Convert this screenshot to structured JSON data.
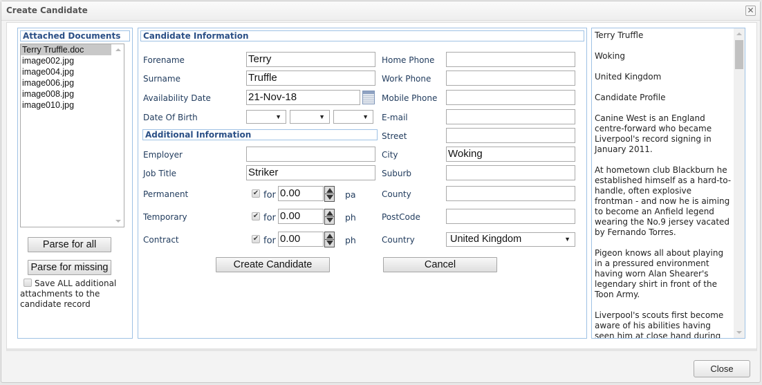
{
  "dialog": {
    "title": "Create Candidate",
    "close_icon": "close-x-icon",
    "footer_close_label": "Close"
  },
  "attached_documents": {
    "legend": "Attached Documents",
    "items": [
      {
        "name": "Terry Truffle.doc",
        "selected": true
      },
      {
        "name": "image002.jpg",
        "selected": false
      },
      {
        "name": "image004.jpg",
        "selected": false
      },
      {
        "name": "image006.jpg",
        "selected": false
      },
      {
        "name": "image008.jpg",
        "selected": false
      },
      {
        "name": "image010.jpg",
        "selected": false
      }
    ],
    "parse_all_label": "Parse for all",
    "parse_missing_label": "Parse for missing",
    "save_all_checked": false,
    "save_all_label": "Save ALL additional attachments to the candidate record"
  },
  "candidate_info": {
    "legend": "Candidate Information",
    "forename": {
      "label": "Forename",
      "value": "Terry"
    },
    "surname": {
      "label": "Surname",
      "value": "Truffle"
    },
    "availability_date": {
      "label": "Availability Date",
      "value": "21-Nov-18"
    },
    "date_of_birth": {
      "label": "Date Of Birth",
      "day": "",
      "month": "",
      "year": ""
    },
    "home_phone": {
      "label": "Home Phone",
      "value": ""
    },
    "work_phone": {
      "label": "Work Phone",
      "value": ""
    },
    "mobile_phone": {
      "label": "Mobile Phone",
      "value": ""
    },
    "email": {
      "label": "E-mail",
      "value": ""
    },
    "street": {
      "label": "Street",
      "value": ""
    },
    "city": {
      "label": "City",
      "value": "Woking"
    },
    "suburb": {
      "label": "Suburb",
      "value": ""
    },
    "county": {
      "label": "County",
      "value": ""
    },
    "postcode": {
      "label": "PostCode",
      "value": ""
    },
    "country": {
      "label": "Country",
      "value": "United Kingdom"
    }
  },
  "additional_info": {
    "legend": "Additional Information",
    "employer": {
      "label": "Employer",
      "value": ""
    },
    "job_title": {
      "label": "Job Title",
      "value": "Striker"
    },
    "for_label": "for",
    "permanent": {
      "label": "Permanent",
      "checked": true,
      "value": "0.00",
      "unit": "pa"
    },
    "temporary": {
      "label": "Temporary",
      "checked": true,
      "value": "0.00",
      "unit": "ph"
    },
    "contract": {
      "label": "Contract",
      "checked": true,
      "value": "0.00",
      "unit": "ph"
    }
  },
  "actions": {
    "create_label": "Create Candidate",
    "cancel_label": "Cancel"
  },
  "cv_text": "Terry Truffle\n\nWoking\n\nUnited Kingdom\n\nCandidate Profile\n\nCanine West is an England centre-forward who became Liverpool's record signing in January 2011.\n\nAt hometown club Blackburn he established himself as a hard-to-handle, often explosive frontman - and now he is aiming to become an Anfield legend wearing the No.9 jersey vacated by Fernando Torres.\n\nPigeon knows all about playing in a pressured environment having worn Alan Shearer's legendary shirt in front of the Toon Army.\n\nLiverpool's scouts first become aware of his abilities having seen him at close hand during"
}
